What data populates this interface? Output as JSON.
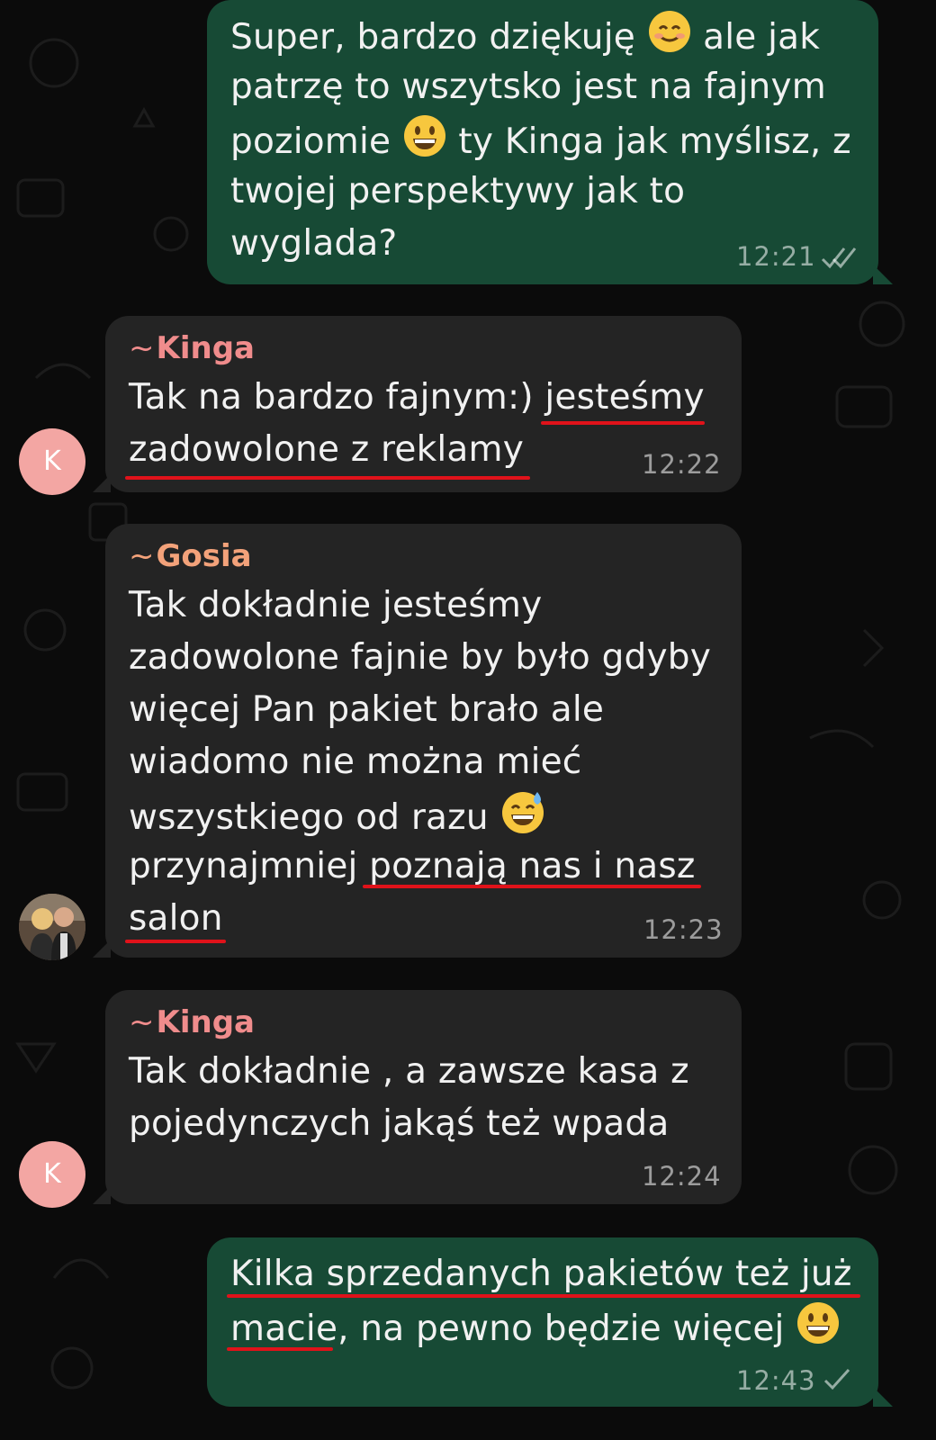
{
  "chat": {
    "messages": [
      {
        "direction": "outgoing",
        "lines": [
          "Super, bardzo dziękuję ",
          "patrzę to wszytsko jest na fajnym",
          "poziomie ",
          "twojej perspektywy jak to",
          "wyglada?"
        ],
        "line1_tail": "ale jak",
        "line3_tail": "ty Kinga jak myślisz, z",
        "time": "12:21",
        "status": "read"
      },
      {
        "direction": "incoming",
        "sender": "Kinga",
        "sender_prefix": "~",
        "sender_color": "#f08c8c",
        "avatar_initial": "K",
        "lines": [
          "Tak na bardzo fajnym:) jesteśmy",
          "zadowolone z reklamy"
        ],
        "time": "12:22"
      },
      {
        "direction": "incoming",
        "sender": "Gosia",
        "sender_prefix": "~",
        "sender_color": "#f3a27a",
        "lines": [
          "Tak dokładnie jesteśmy",
          "zadowolone fajnie by było gdyby",
          "więcej Pan pakiet brało ale",
          "wiadomo nie można mieć",
          "wszystkiego od razu ",
          "przynajmniej poznają nas i nasz",
          "salon"
        ],
        "time": "12:23"
      },
      {
        "direction": "incoming",
        "sender": "Kinga",
        "sender_prefix": "~",
        "sender_color": "#f08c8c",
        "avatar_initial": "K",
        "lines": [
          "Tak dokładnie , a zawsze kasa z",
          "pojedynczych jakąś też wpada"
        ],
        "time": "12:24"
      },
      {
        "direction": "outgoing",
        "lines": [
          "Kilka sprzedanych pakietów też już",
          "macie, na pewno będzie więcej "
        ],
        "time": "12:43",
        "status": "sent"
      }
    ],
    "icons": {
      "emoji_1": "smiling-face-with-smiling-eyes-emoji",
      "emoji_2": "grinning-face-emoji",
      "emoji_3": "grinning-face-with-sweat-emoji",
      "emoji_4": "grinning-face-emoji",
      "double_check": "double-check-icon",
      "single_check": "single-check-icon"
    },
    "colors": {
      "background": "#0b0b0b",
      "outgoing_bubble": "#174a35",
      "incoming_bubble": "#242424",
      "highlight_underline": "#e0121a"
    }
  }
}
